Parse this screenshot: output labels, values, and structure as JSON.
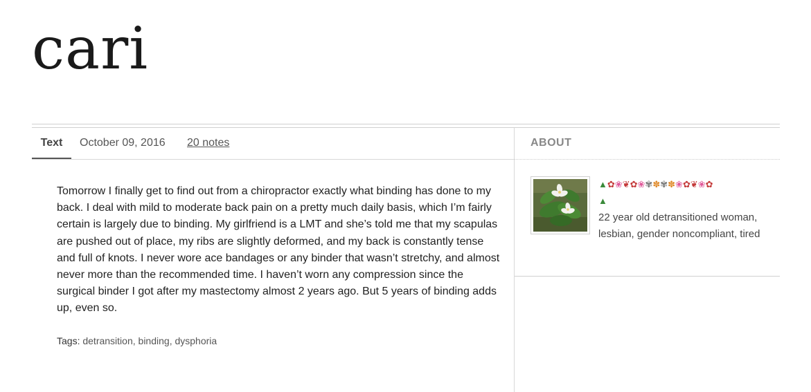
{
  "blog": {
    "title": "cari"
  },
  "post": {
    "type_label": "Text",
    "date": "October 09, 2016",
    "notes": "20 notes",
    "body": "Tomorrow I finally get to find out from a chiropractor exactly what binding has done to my back. I deal with mild to moderate back pain on a pretty much daily basis, which I’m fairly certain is largely due to binding. My girlfriend is a LMT and she’s told me that my scapulas are pushed out of place, my ribs are slightly deformed, and my back is constantly tense and full of knots. I never wore ace bandages or any binder that wasn’t stretchy, and almost never more than the recommended time. I haven’t worn any compression since the surgical binder I got after my mastectomy almost 2 years ago. But 5 years of binding adds up, even so.",
    "tags_label": "Tags:",
    "tags": [
      "detransition",
      "binding",
      "dysphoria"
    ]
  },
  "sidebar": {
    "about_title": "ABOUT",
    "emoji_line": [
      "evergreen-tree",
      "rose",
      "cherry-blossom",
      "tulip",
      "rose",
      "cherry-blossom",
      "white-flower",
      "blossom",
      "white-flower",
      "blossom",
      "cherry-blossom",
      "rose",
      "tulip",
      "cherry-blossom",
      "rose",
      "evergreen-tree"
    ],
    "description": "22 year old detransitioned woman, lesbian, gender noncompliant, tired",
    "avatar_icon": "trillium-flower-photo"
  },
  "colors": {
    "text": "#222222",
    "muted": "#555555",
    "rule": "#d8d8d8",
    "about_title": "#888888"
  }
}
